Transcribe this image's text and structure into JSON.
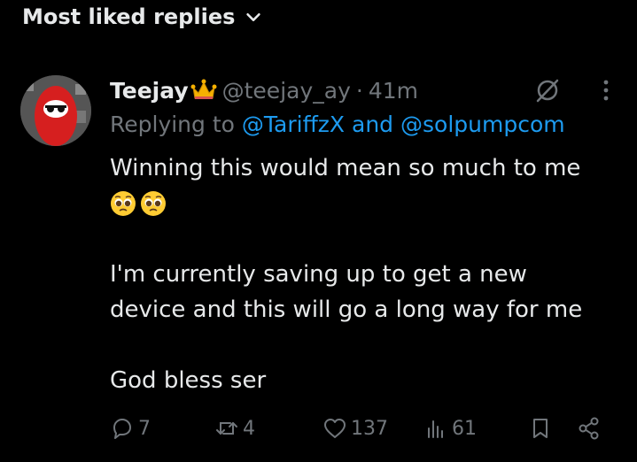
{
  "section": {
    "title": "Most liked replies"
  },
  "reply": {
    "author_name": "Teejay",
    "handle": "@teejay_ay",
    "separator": "·",
    "time": "41m",
    "replying_prefix": "Replying to",
    "replying_to_1": "@TariffzX",
    "replying_and": "and",
    "replying_to_2": "@solpumpcom",
    "text_line_1": "Winning this would mean so much to me",
    "text_line_2": "I'm currently saving up to get a new",
    "text_line_3": "device and this will go a long way for me",
    "text_line_4": "God bless ser"
  },
  "stats": {
    "replies": "7",
    "reposts": "4",
    "likes": "137",
    "views": "61"
  },
  "icons": [
    "chevron-down-icon",
    "crown-icon",
    "grok-icon",
    "more-icon",
    "pleading-face-icon",
    "reply-icon",
    "repost-icon",
    "like-icon",
    "views-icon",
    "bookmark-icon",
    "share-icon"
  ],
  "colors": {
    "background": "#000000",
    "text": "#e7e9ea",
    "muted": "#71767b",
    "link": "#1d9bf0"
  }
}
